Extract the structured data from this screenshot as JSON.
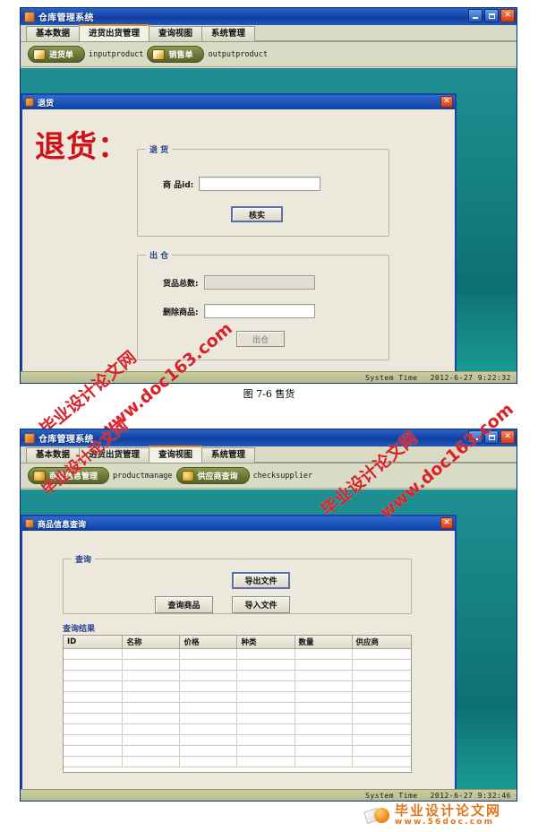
{
  "figure1": {
    "app": {
      "title": "仓库管理系统",
      "icon": "warehouse-icon",
      "window_controls": {
        "minimize": "_",
        "maximize": "□",
        "close": "✕"
      },
      "tabs": [
        {
          "label": "基本数据",
          "active": false
        },
        {
          "label": "进货出货管理",
          "active": true
        },
        {
          "label": "查询视图",
          "active": false
        },
        {
          "label": "系统管理",
          "active": false
        }
      ],
      "toolbar": [
        {
          "label": "进货单",
          "code": "inputproduct",
          "icon": "invoice-icon"
        },
        {
          "label": "销售单",
          "code": "outputproduct",
          "icon": "sales-icon"
        }
      ],
      "status": {
        "label": "System Time",
        "value": "2012-6-27 9:22:32"
      }
    },
    "dialog": {
      "title": "退货",
      "close_label": "✕",
      "heading": "退货：",
      "group_return": {
        "label": "退  货",
        "field_label": "商 品id:",
        "field_value": "",
        "button": "核实"
      },
      "group_out": {
        "label": "出  仓",
        "total_label": "货品总数:",
        "total_value": "",
        "delete_label": "删除商品:",
        "delete_value": "",
        "button": "出仓"
      }
    },
    "caption": "图 7-6 售货"
  },
  "figure2": {
    "app": {
      "title": "仓库管理系统",
      "icon": "warehouse-icon",
      "window_controls": {
        "minimize": "_",
        "maximize": "□",
        "close": "✕"
      },
      "tabs": [
        {
          "label": "基本数据",
          "active": false
        },
        {
          "label": "进货出货管理",
          "active": false
        },
        {
          "label": "查询视图",
          "active": true
        },
        {
          "label": "系统管理",
          "active": false
        }
      ],
      "toolbar": [
        {
          "label": "商品信息管理",
          "code": "productmanage",
          "icon": "box-icon"
        },
        {
          "label": "供应商查询",
          "code": "checksupplier",
          "icon": "supplier-icon"
        }
      ],
      "status": {
        "label": "System Time",
        "value": "2012-6-27 9:32:46"
      }
    },
    "dialog": {
      "title": "商品信息查询",
      "close_label": "✕",
      "group_query": {
        "label": "查询",
        "export_button": "导出文件",
        "search_button": "查询商品",
        "import_button": "导入文件"
      },
      "group_result": {
        "label": "查询结果",
        "columns": [
          "ID",
          "名称",
          "价格",
          "种类",
          "数量",
          "供应商"
        ],
        "row_count": 11
      }
    }
  },
  "watermarks": [
    "毕业设计论文网",
    "www.doc163.com"
  ],
  "footer": {
    "logo_cn": "毕业设计论文网",
    "logo_en": "www.56doc.com"
  },
  "colors": {
    "title_blue": "#1546ab",
    "desktop_teal": "#14807f",
    "form_bg": "#ece9dc",
    "toolbar_bg": "#d9dbc4",
    "accent_red": "#cf1118",
    "pill_green": "#6e7b38",
    "watermark_red": "#d8232a",
    "logo_orange": "#e2761b"
  }
}
